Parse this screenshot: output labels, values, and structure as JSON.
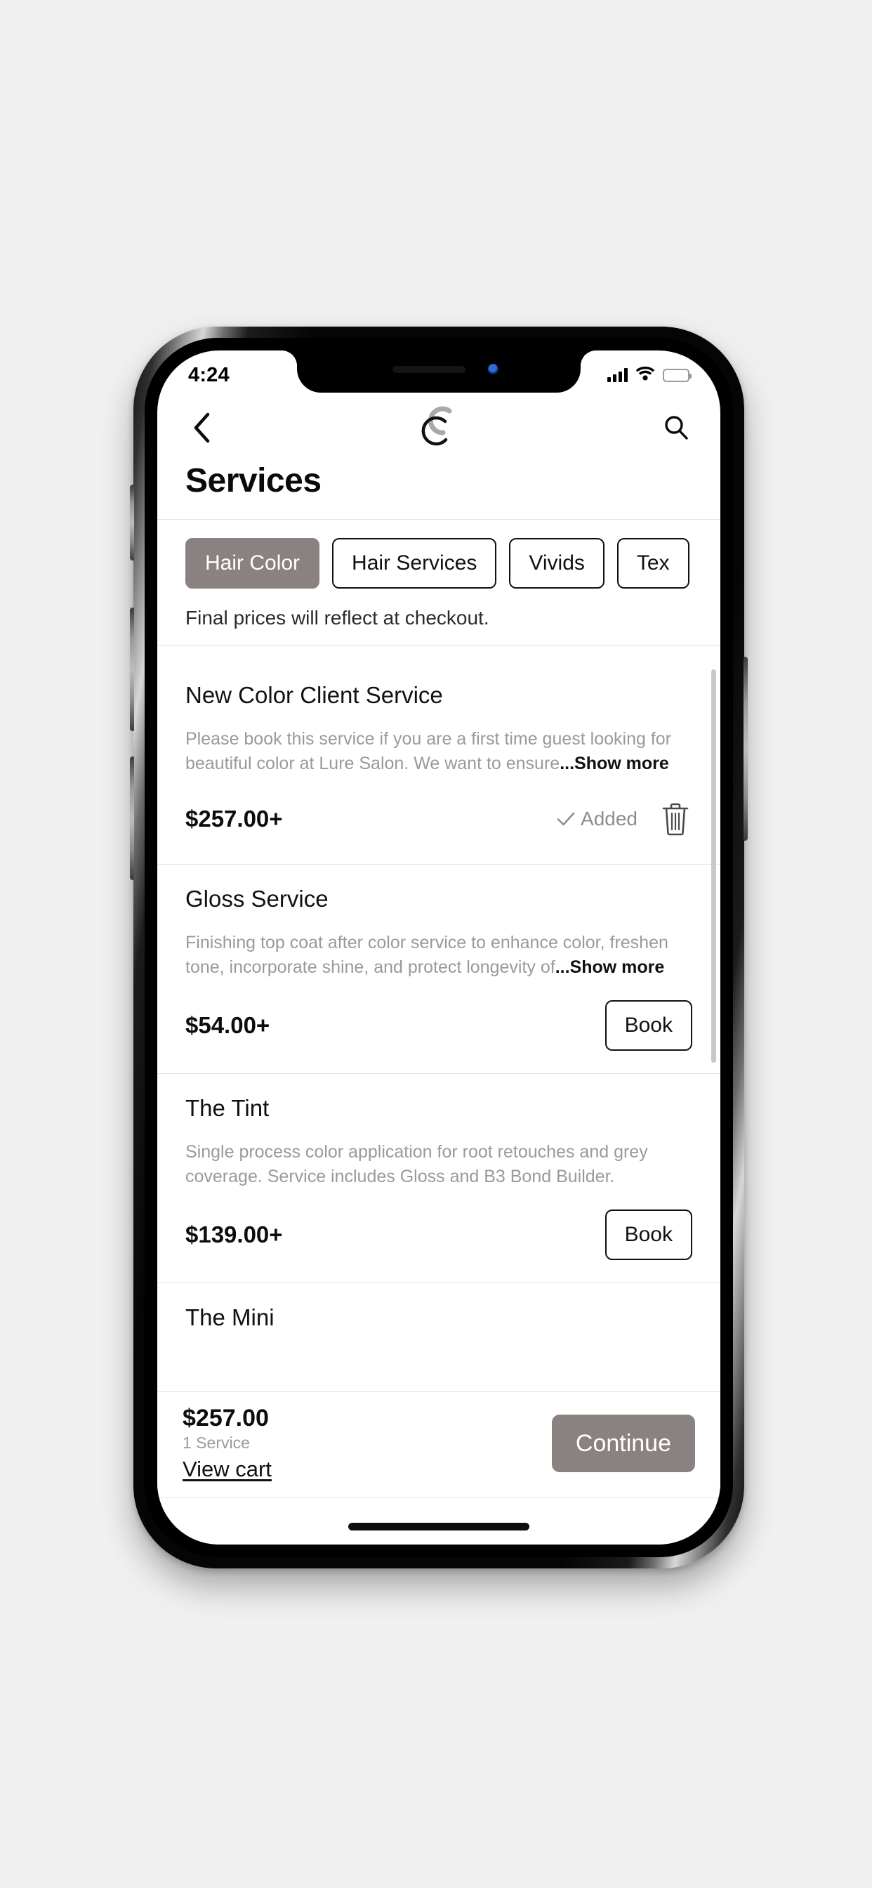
{
  "status_bar": {
    "time": "4:24",
    "cellular_icon": "cellular-bars-icon",
    "wifi_icon": "wifi-icon",
    "battery_icon": "battery-icon",
    "battery_color": "#f5c518",
    "battery_level_percent": 100
  },
  "header": {
    "back_icon": "chevron-left-icon",
    "logo_icon": "swirl-logo-icon",
    "search_icon": "search-icon",
    "title": "Services"
  },
  "filters": {
    "tabs": [
      {
        "label": "Hair Color",
        "active": true
      },
      {
        "label": "Hair Services",
        "active": false
      },
      {
        "label": "Vivids",
        "active": false
      },
      {
        "label": "Tex",
        "active": false
      }
    ],
    "note": "Final prices will reflect at checkout.",
    "active_tab_color": "#8a8280"
  },
  "services": [
    {
      "name": "New Color Client Service",
      "description": "Please book this service if you are a first time guest looking for beautiful color at Lure Salon. We want to ensure",
      "show_more": "...Show more",
      "price": "$257.00+",
      "state": "added",
      "added_label": "Added",
      "check_icon": "check-icon",
      "delete_icon": "trash-icon"
    },
    {
      "name": "Gloss Service",
      "description": "Finishing top coat after color service to enhance color, freshen tone, incorporate shine, and protect longevity of",
      "show_more": "...Show more",
      "price": "$54.00+",
      "state": "bookable",
      "book_label": "Book"
    },
    {
      "name": "The Tint",
      "description": "Single process color application for root retouches and grey coverage. Service includes Gloss and B3 Bond Builder.",
      "show_more": "",
      "price": "$139.00+",
      "state": "bookable",
      "book_label": "Book"
    },
    {
      "name": "The Mini",
      "description": "",
      "show_more": "",
      "price": "",
      "state": "partial"
    }
  ],
  "cart_bar": {
    "total": "$257.00",
    "count_label": "1 Service",
    "view_cart_label": "View cart",
    "continue_label": "Continue",
    "continue_color": "#8a8280"
  }
}
